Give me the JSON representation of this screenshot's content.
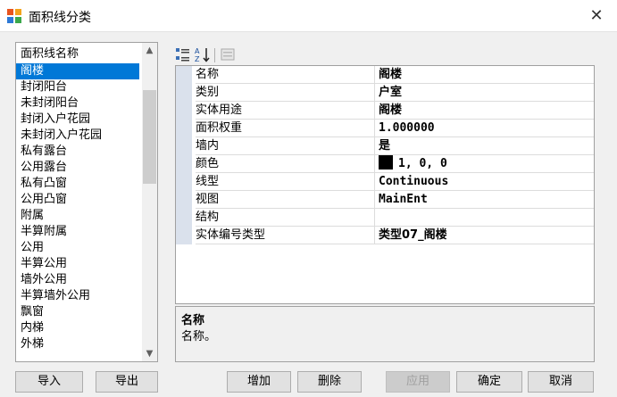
{
  "window": {
    "title": "面积线分类",
    "close_glyph": "✕"
  },
  "list": {
    "header": "面积线名称",
    "items": [
      "阁楼",
      "封闭阳台",
      "未封闭阳台",
      "封闭入户花园",
      "未封闭入户花园",
      "私有露台",
      "公用露台",
      "私有凸窗",
      "公用凸窗",
      "附属",
      "半算附属",
      "公用",
      "半算公用",
      "墙外公用",
      "半算墙外公用",
      "飘窗",
      "内梯",
      "外梯"
    ],
    "selected_index": 0
  },
  "properties": {
    "rows": [
      {
        "name": "名称",
        "value": "阁楼"
      },
      {
        "name": "类别",
        "value": "户室"
      },
      {
        "name": "实体用途",
        "value": "阁楼"
      },
      {
        "name": "面积权重",
        "value": "1.000000"
      },
      {
        "name": "墙内",
        "value": "是"
      },
      {
        "name": "颜色",
        "value": "1, 0, 0",
        "swatch": "#000000"
      },
      {
        "name": "线型",
        "value": "Continuous"
      },
      {
        "name": "视图",
        "value": "MainEnt"
      },
      {
        "name": "结构",
        "value": ""
      },
      {
        "name": "实体编号类型",
        "value": "类型07_阁楼"
      }
    ]
  },
  "description": {
    "title": "名称",
    "text": "名称。"
  },
  "buttons": {
    "import": "导入",
    "export": "导出",
    "add": "增加",
    "delete": "删除",
    "apply": "应用",
    "ok": "确定",
    "cancel": "取消"
  }
}
